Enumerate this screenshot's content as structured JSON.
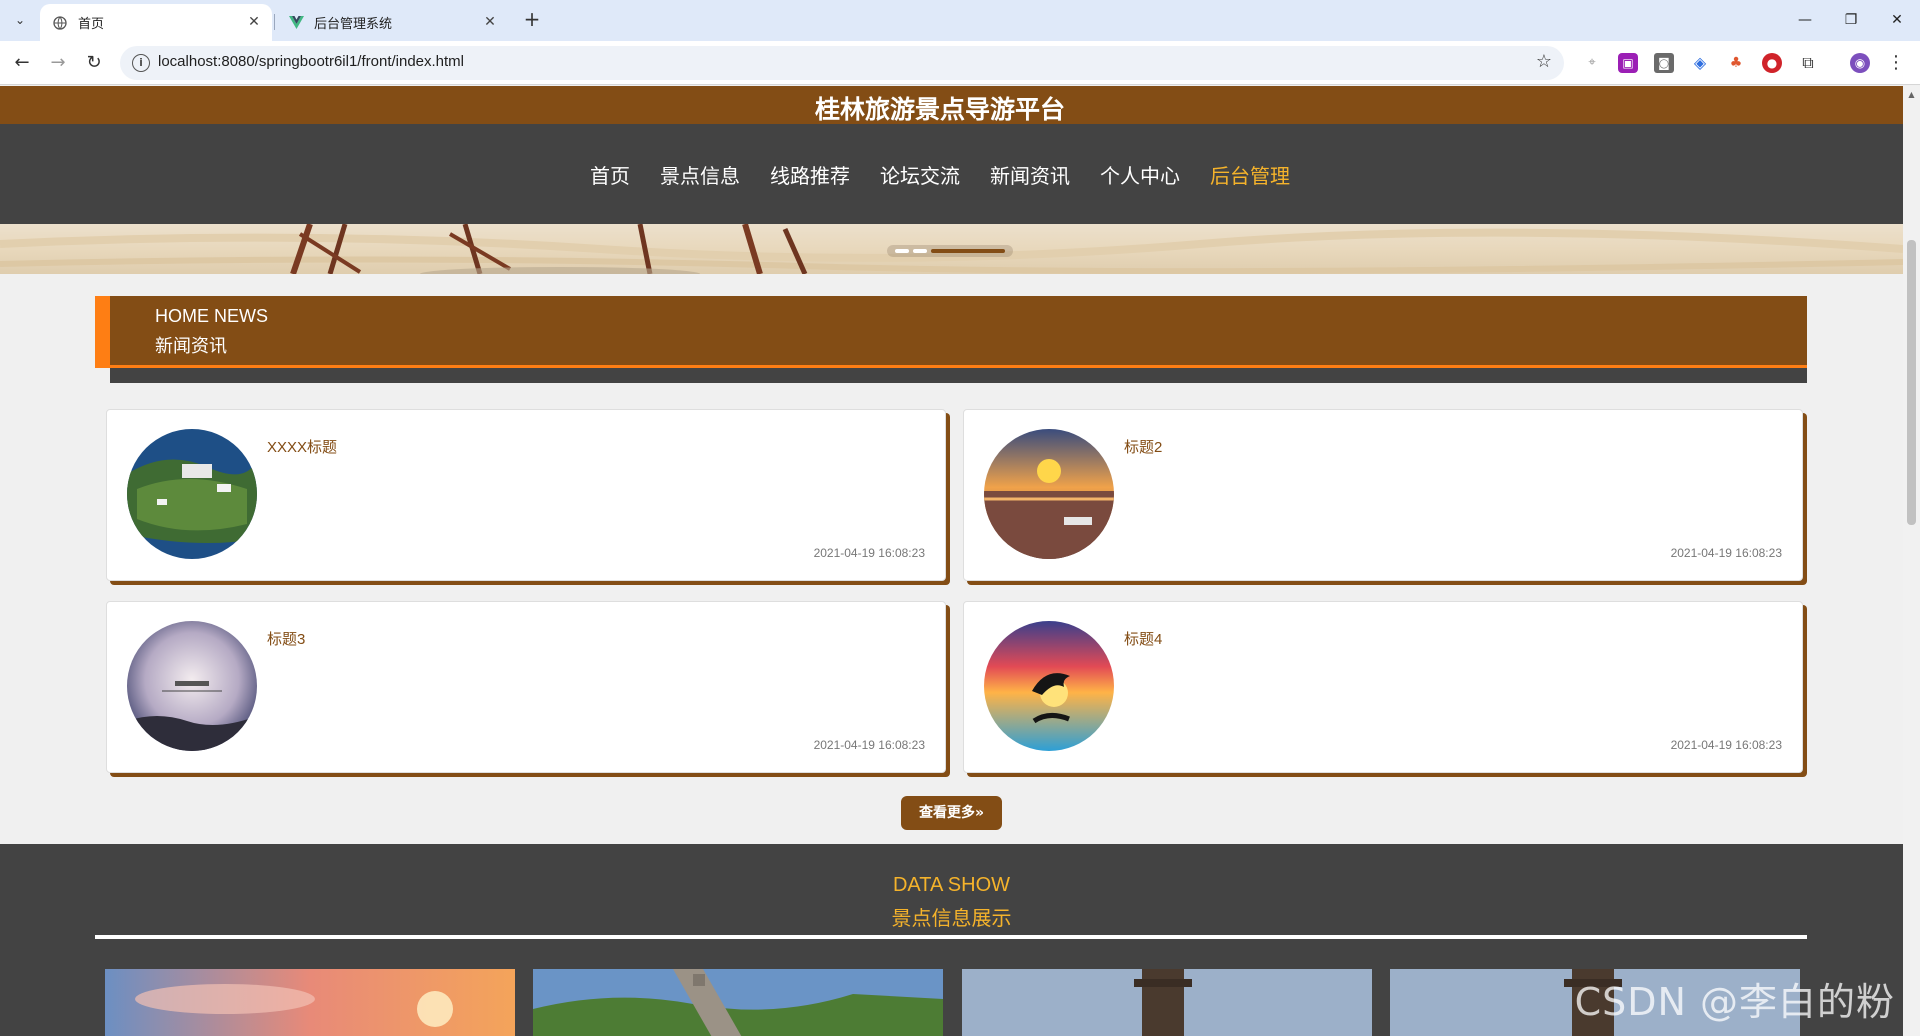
{
  "browser": {
    "tabs": [
      {
        "label": "首页",
        "active": true,
        "icon": "globe-icon"
      },
      {
        "label": "后台管理系统",
        "active": false,
        "icon": "vue-logo-icon"
      }
    ],
    "url": "localhost:8080/springbootr6il1/front/index.html"
  },
  "site": {
    "title": "桂林旅游景点导游平台",
    "nav": [
      "首页",
      "景点信息",
      "线路推荐",
      "论坛交流",
      "新闻资讯",
      "个人中心",
      "后台管理"
    ],
    "active_nav": "后台管理",
    "colors": {
      "brand": "#834d15",
      "accent": "#f5b32b",
      "orange": "#fe7e14",
      "dark": "#434343"
    }
  },
  "news": {
    "heading_en": "HOME NEWS",
    "heading_cn": "新闻资讯",
    "items": [
      {
        "title": "XXXX标题",
        "time": "2021-04-19 16:08:23"
      },
      {
        "title": "标题2",
        "time": "2021-04-19 16:08:23"
      },
      {
        "title": "标题3",
        "time": "2021-04-19 16:08:23"
      },
      {
        "title": "标题4",
        "time": "2021-04-19 16:08:23"
      }
    ],
    "more_label": "查看更多"
  },
  "data_show": {
    "heading_en": "DATA SHOW",
    "heading_cn": "景点信息展示"
  },
  "watermark": "CSDN @李白的粉"
}
